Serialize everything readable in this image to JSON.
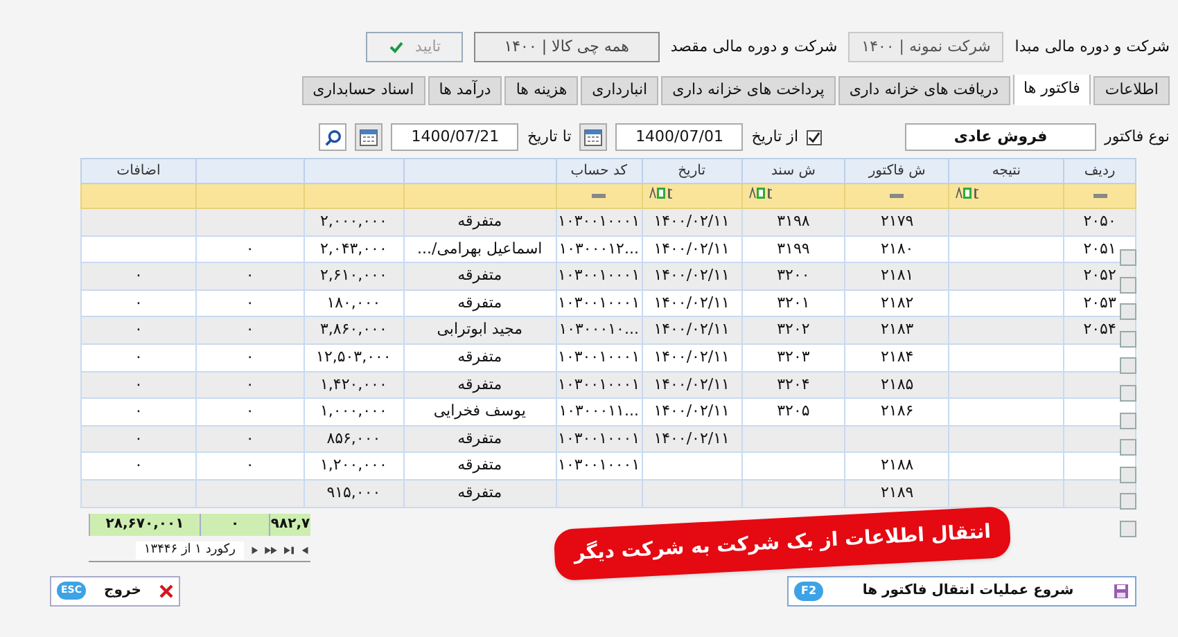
{
  "source": {
    "label": "شرکت و دوره مالی مبدا",
    "value": "شرکت نمونه | ۱۴۰۰"
  },
  "target": {
    "label": "شرکت و دوره مالی مقصد",
    "value": "همه چی کالا | ۱۴۰۰"
  },
  "confirm_button": {
    "label": "تایید",
    "disabled": true
  },
  "tabs": [
    {
      "label": "اطلاعات",
      "selected": false
    },
    {
      "label": "فاکتور ها",
      "selected": true
    },
    {
      "label": "دریافت های خزانه داری",
      "selected": false
    },
    {
      "label": "پرداخت های خزانه داری",
      "selected": false
    },
    {
      "label": "انبارداری",
      "selected": false
    },
    {
      "label": "هزینه ها",
      "selected": false
    },
    {
      "label": "درآمد ها",
      "selected": false
    },
    {
      "label": "اسناد حسابداری",
      "selected": false
    }
  ],
  "filters": {
    "invoice_type_label": "نوع فاکتور",
    "invoice_type": "فروش عادی",
    "from_date_checked": true,
    "from_date_label": "از تاریخ",
    "from_date": "1400/07/01",
    "to_date_label": "تا تاریخ",
    "to_date": "1400/07/21"
  },
  "table": {
    "columns": [
      {
        "label": "ردیف",
        "kind": "number"
      },
      {
        "label": "نتیجه",
        "kind": "text"
      },
      {
        "label": "ش فاکتور",
        "kind": "number"
      },
      {
        "label": "ش سند",
        "kind": "text"
      },
      {
        "label": "تاریخ",
        "kind": "text"
      },
      {
        "label": "کد حساب",
        "kind": "number"
      },
      {},
      {},
      {},
      {
        "label": "اضافات"
      }
    ],
    "rows": [
      [
        "۲۰۵۰",
        null,
        "۲۱۷۹",
        "۳۱۹۸",
        "۱۴۰۰/۰۲/۱۱",
        "۱۰۳۰۰۱۰۰۰۱",
        "متفرقه",
        "۲,۰۰۰,۰۰۰",
        null,
        null
      ],
      [
        "۲۰۵۱",
        null,
        "۲۱۸۰",
        "۳۱۹۹",
        "۱۴۰۰/۰۲/۱۱",
        "...۱۰۳۰۰۰۱۲",
        "اسماعیل بهرامی/...",
        "۲,۰۴۳,۰۰۰",
        "۰",
        null
      ],
      [
        "۲۰۵۲",
        null,
        "۲۱۸۱",
        "۳۲۰۰",
        "۱۴۰۰/۰۲/۱۱",
        "۱۰۳۰۰۱۰۰۰۱",
        "متفرقه",
        "۲,۶۱۰,۰۰۰",
        "۰",
        "۰"
      ],
      [
        "۲۰۵۳",
        null,
        "۲۱۸۲",
        "۳۲۰۱",
        "۱۴۰۰/۰۲/۱۱",
        "۱۰۳۰۰۱۰۰۰۱",
        "متفرقه",
        "۱۸۰,۰۰۰",
        "۰",
        "۰"
      ],
      [
        "۲۰۵۴",
        null,
        "۲۱۸۳",
        "۳۲۰۲",
        "۱۴۰۰/۰۲/۱۱",
        "...۱۰۳۰۰۰۱۰",
        "مجید ابوترابی",
        "۳,۸۶۰,۰۰۰",
        "۰",
        "۰"
      ],
      [
        null,
        null,
        "۲۱۸۴",
        "۳۲۰۳",
        "۱۴۰۰/۰۲/۱۱",
        "۱۰۳۰۰۱۰۰۰۱",
        "متفرقه",
        "۱۲,۵۰۳,۰۰۰",
        "۰",
        "۰"
      ],
      [
        null,
        null,
        "۲۱۸۵",
        "۳۲۰۴",
        "۱۴۰۰/۰۲/۱۱",
        "۱۰۳۰۰۱۰۰۰۱",
        "متفرقه",
        "۱,۴۲۰,۰۰۰",
        "۰",
        "۰"
      ],
      [
        null,
        null,
        "۲۱۸۶",
        "۳۲۰۵",
        "۱۴۰۰/۰۲/۱۱",
        "...۱۰۳۰۰۰۱۱",
        "یوسف فخرایی",
        "۱,۰۰۰,۰۰۰",
        "۰",
        "۰"
      ],
      [
        null,
        null,
        null,
        null,
        "۱۴۰۰/۰۲/۱۱",
        "۱۰۳۰۰۱۰۰۰۱",
        "متفرقه",
        "۸۵۶,۰۰۰",
        "۰",
        "۰"
      ],
      [
        null,
        null,
        "۲۱۸۸",
        null,
        null,
        "۱۰۳۰۰۱۰۰۰۱",
        "متفرقه",
        "۱,۲۰۰,۰۰۰",
        "۰",
        "۰"
      ],
      [
        null,
        null,
        "۲۱۸۹",
        null,
        null,
        null,
        "متفرقه",
        "۹۱۵,۰۰۰",
        null,
        null
      ]
    ]
  },
  "totals": [
    "۹۸۲,۷",
    "۰",
    "۲۸,۶۷۰,۰۰۱"
  ],
  "record_nav": "رکورد ۱ از ۱۳۴۴۶",
  "callout": "انتقال اطلاعات از یک شرکت به شرکت دیگر",
  "start_button": {
    "label": "شروع عملیات انتقال فاکتور ها",
    "shortcut": "F2"
  },
  "exit_button": {
    "label": "خروج",
    "shortcut": "ESC"
  }
}
